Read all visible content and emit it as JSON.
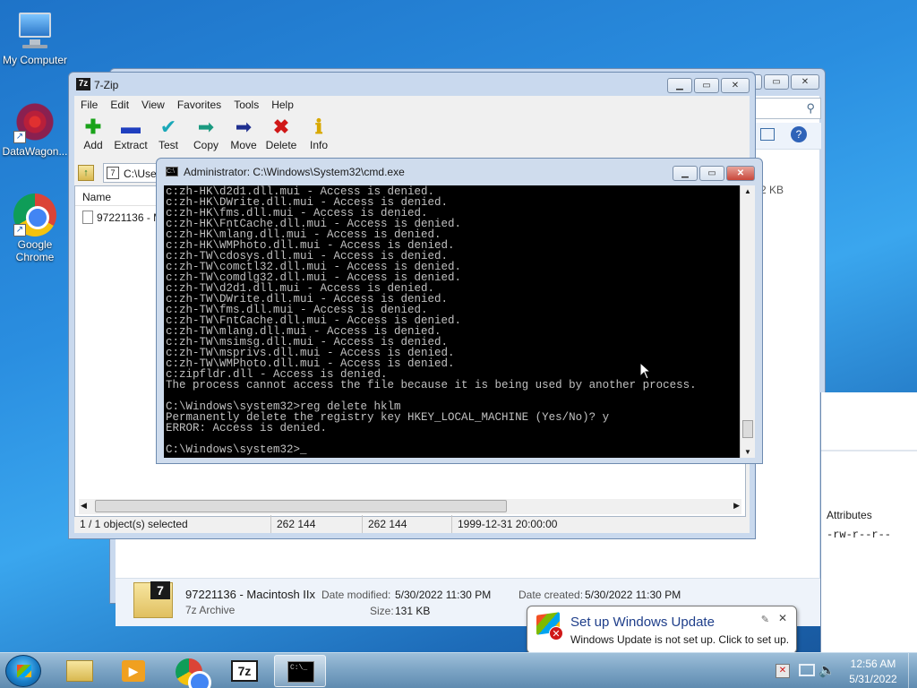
{
  "desktop": {
    "icons": [
      {
        "label": "My Computer"
      },
      {
        "label": "DataWagon..."
      },
      {
        "label": "Google Chrome"
      }
    ]
  },
  "explorer": {
    "search_icon": "search-icon",
    "size_partial": "2 KB",
    "attributes_header": "Attributes",
    "attributes_value": "-rw-r--r--",
    "details": {
      "name": "97221136 - Macintosh IIx",
      "type": "7z Archive",
      "date_modified_label": "Date modified:",
      "date_modified": "5/30/2022 11:30 PM",
      "date_created_label": "Date created:",
      "date_created": "5/30/2022 11:30 PM",
      "size_label": "Size:",
      "size": "131 KB"
    }
  },
  "sevenzip": {
    "title": "7-Zip",
    "menu": [
      "File",
      "Edit",
      "View",
      "Favorites",
      "Tools",
      "Help"
    ],
    "toolbar": [
      {
        "label": "Add",
        "icon": "plus-icon",
        "color": "#1aa31a"
      },
      {
        "label": "Extract",
        "icon": "minus-icon",
        "color": "#1f3fbf"
      },
      {
        "label": "Test",
        "icon": "check-icon",
        "color": "#1aa8b8"
      },
      {
        "label": "Copy",
        "icon": "copy-arrow-icon",
        "color": "#1a9a80"
      },
      {
        "label": "Move",
        "icon": "move-arrow-icon",
        "color": "#1f2f8f"
      },
      {
        "label": "Delete",
        "icon": "delete-x-icon",
        "color": "#d01818"
      },
      {
        "label": "Info",
        "icon": "info-icon",
        "color": "#d8a800"
      }
    ],
    "address": "C:\\Use",
    "column_name": "Name",
    "file_row": "97221136 - M",
    "status": {
      "selection": "1 / 1 object(s) selected",
      "size": "262 144",
      "packed": "262 144",
      "date": "1999-12-31 20:00:00"
    }
  },
  "cmd": {
    "title": "Administrator: C:\\Windows\\System32\\cmd.exe",
    "lines": [
      "c:zh-HK\\d2d1.dll.mui - Access is denied.",
      "c:zh-HK\\DWrite.dll.mui - Access is denied.",
      "c:zh-HK\\fms.dll.mui - Access is denied.",
      "c:zh-HK\\FntCache.dll.mui - Access is denied.",
      "c:zh-HK\\mlang.dll.mui - Access is denied.",
      "c:zh-HK\\WMPhoto.dll.mui - Access is denied.",
      "c:zh-TW\\cdosys.dll.mui - Access is denied.",
      "c:zh-TW\\comctl32.dll.mui - Access is denied.",
      "c:zh-TW\\comdlg32.dll.mui - Access is denied.",
      "c:zh-TW\\d2d1.dll.mui - Access is denied.",
      "c:zh-TW\\DWrite.dll.mui - Access is denied.",
      "c:zh-TW\\fms.dll.mui - Access is denied.",
      "c:zh-TW\\FntCache.dll.mui - Access is denied.",
      "c:zh-TW\\mlang.dll.mui - Access is denied.",
      "c:zh-TW\\msimsg.dll.mui - Access is denied.",
      "c:zh-TW\\msprivs.dll.mui - Access is denied.",
      "c:zh-TW\\WMPhoto.dll.mui - Access is denied.",
      "c:zipfldr.dll - Access is denied.",
      "The process cannot access the file because it is being used by another process.",
      "",
      "C:\\Windows\\system32>reg delete hklm",
      "Permanently delete the registry key HKEY_LOCAL_MACHINE (Yes/No)? y",
      "ERROR: Access is denied.",
      "",
      "C:\\Windows\\system32>_"
    ]
  },
  "balloon": {
    "title": "Set up Windows Update",
    "text": "Windows Update is not set up. Click to set up."
  },
  "taskbar": {
    "time": "12:56 AM",
    "date": "5/31/2022"
  }
}
